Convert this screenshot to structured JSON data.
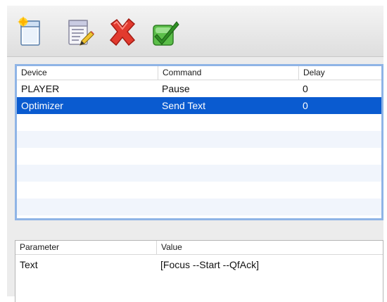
{
  "toolbar": {
    "buttons": [
      {
        "name": "new-command-icon"
      },
      {
        "name": "edit-command-icon"
      },
      {
        "name": "delete-command-icon"
      },
      {
        "name": "confirm-command-icon"
      }
    ]
  },
  "commands_table": {
    "headers": {
      "device": "Device",
      "command": "Command",
      "delay": "Delay"
    },
    "rows": [
      {
        "device": "PLAYER",
        "command": "Pause",
        "delay": "0",
        "selected": false
      },
      {
        "device": "Optimizer",
        "command": "Send Text",
        "delay": "0",
        "selected": true
      }
    ]
  },
  "params_table": {
    "headers": {
      "parameter": "Parameter",
      "value": "Value"
    },
    "rows": [
      {
        "parameter": "Text",
        "value": "[Focus --Start --QfAck]"
      }
    ]
  },
  "colors": {
    "selection": "#0a5bd0",
    "alt_row": "#f1f5fc",
    "focus_ring": "#8fb4e6"
  }
}
